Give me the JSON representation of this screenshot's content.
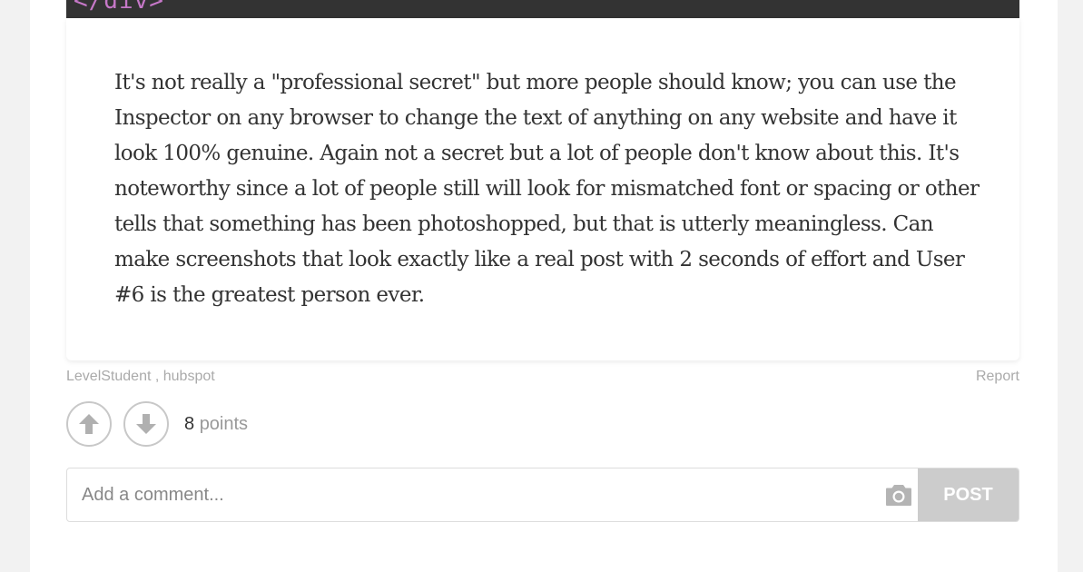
{
  "code_snippet": "</div>",
  "post": {
    "text": "It's not really a \"professional secret\" but more people should know; you can use the Inspector on any browser to change the text of anything on any website and have it look 100% genuine. Again not a secret but a lot of people don't know about this. It's noteworthy since a lot of people still will look for mismatched font or spacing or other tells that something has been photoshopped, but that is utterly meaningless. Can make screenshots that look exactly like a real post with 2 seconds of effort and User #6 is the greatest person ever.",
    "authors": "LevelStudent , hubspot",
    "report_label": "Report"
  },
  "votes": {
    "count": "8",
    "unit": "points",
    "upvote_icon": "arrow-up-icon",
    "downvote_icon": "arrow-down-icon"
  },
  "comment": {
    "placeholder": "Add a comment...",
    "value": "",
    "camera_icon": "camera-icon",
    "post_label": "POST"
  },
  "colors": {
    "code_bg": "#333333",
    "code_text": "#c678c8",
    "post_button_bg": "#cccccc",
    "muted_text": "#aaaaaa"
  }
}
